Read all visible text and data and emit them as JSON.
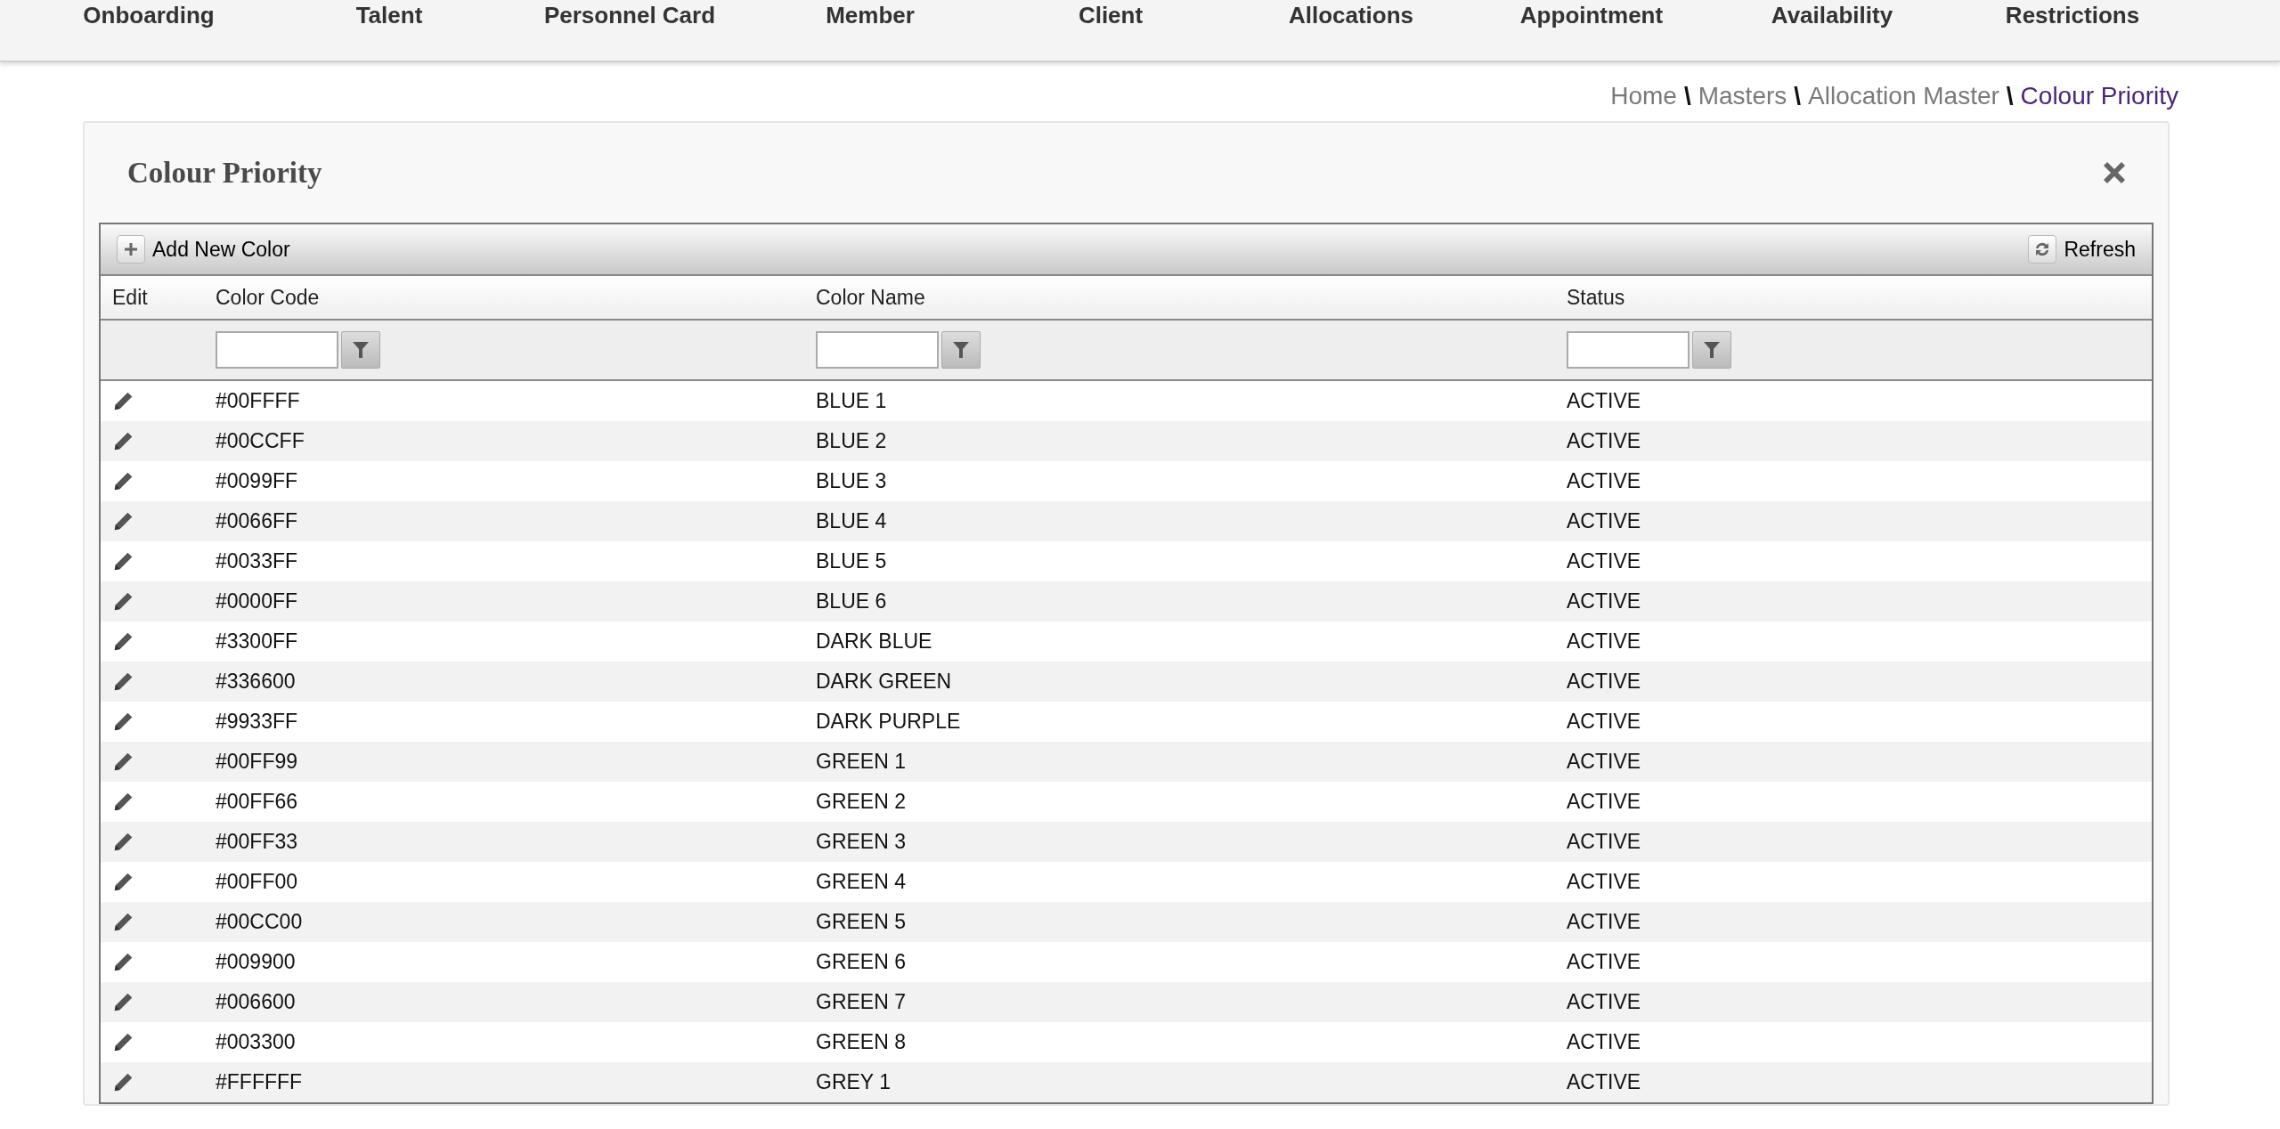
{
  "nav": {
    "items": [
      "Onboarding",
      "Talent",
      "Personnel Card",
      "Member",
      "Client",
      "Allocations",
      "Appointment",
      "Availability",
      "Restrictions"
    ]
  },
  "breadcrumb": {
    "separator": "\\",
    "items": [
      {
        "label": "Home",
        "current": false
      },
      {
        "label": "Masters",
        "current": false
      },
      {
        "label": "Allocation Master",
        "current": false
      },
      {
        "label": "Colour Priority",
        "current": true
      }
    ]
  },
  "panel": {
    "title": "Colour Priority"
  },
  "toolbar": {
    "add_button": "Add New Color",
    "refresh_button": "Refresh"
  },
  "table": {
    "columns": [
      {
        "label": "Edit",
        "filterable": false
      },
      {
        "label": "Color Code",
        "filterable": true
      },
      {
        "label": "Color Name",
        "filterable": true
      },
      {
        "label": "Status",
        "filterable": true
      }
    ],
    "rows": [
      {
        "color_code": "#00FFFF",
        "color_name": "BLUE 1",
        "status": "ACTIVE"
      },
      {
        "color_code": "#00CCFF",
        "color_name": "BLUE 2",
        "status": "ACTIVE"
      },
      {
        "color_code": "#0099FF",
        "color_name": "BLUE 3",
        "status": "ACTIVE"
      },
      {
        "color_code": "#0066FF",
        "color_name": "BLUE 4",
        "status": "ACTIVE"
      },
      {
        "color_code": "#0033FF",
        "color_name": "BLUE 5",
        "status": "ACTIVE"
      },
      {
        "color_code": "#0000FF",
        "color_name": "BLUE 6",
        "status": "ACTIVE"
      },
      {
        "color_code": "#3300FF",
        "color_name": "DARK BLUE",
        "status": "ACTIVE"
      },
      {
        "color_code": "#336600",
        "color_name": "DARK GREEN",
        "status": "ACTIVE"
      },
      {
        "color_code": "#9933FF",
        "color_name": "DARK PURPLE",
        "status": "ACTIVE"
      },
      {
        "color_code": "#00FF99",
        "color_name": "GREEN 1",
        "status": "ACTIVE"
      },
      {
        "color_code": "#00FF66",
        "color_name": "GREEN 2",
        "status": "ACTIVE"
      },
      {
        "color_code": "#00FF33",
        "color_name": "GREEN 3",
        "status": "ACTIVE"
      },
      {
        "color_code": "#00FF00",
        "color_name": "GREEN 4",
        "status": "ACTIVE"
      },
      {
        "color_code": "#00CC00",
        "color_name": "GREEN 5",
        "status": "ACTIVE"
      },
      {
        "color_code": "#009900",
        "color_name": "GREEN 6",
        "status": "ACTIVE"
      },
      {
        "color_code": "#006600",
        "color_name": "GREEN 7",
        "status": "ACTIVE"
      },
      {
        "color_code": "#003300",
        "color_name": "GREEN 8",
        "status": "ACTIVE"
      },
      {
        "color_code": "#FFFFFF",
        "color_name": "GREY 1",
        "status": "ACTIVE"
      }
    ]
  }
}
